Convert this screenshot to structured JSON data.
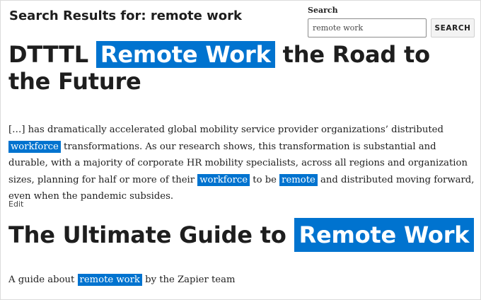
{
  "header": {
    "results_heading": "Search Results for: remote work"
  },
  "search": {
    "label": "Search",
    "value": "remote work",
    "button_label": "SEARCH"
  },
  "posts": [
    {
      "title_before": "DTTTL",
      "title_highlight": "Remote Work",
      "title_after": "the Road to the Future",
      "excerpt": {
        "p1": "[…] has dramatically accelerated global mobility service provider organizations’ distributed",
        "hl1": "workforce",
        "p2": "transformations. As our research shows, this transformation is substantial and durable, with a majority of corporate HR mobility specialists, across all regions and organization sizes, planning for half or more of their",
        "hl2": "workforce",
        "p3": "to be",
        "hl3": "remote",
        "p4": "and distributed moving forward, even when the pandemic subsides."
      },
      "edit_label": "Edit"
    },
    {
      "title_before": "The Ultimate Guide to",
      "title_highlight": "Remote Work",
      "excerpt": {
        "p1": "A guide about",
        "hl1": "remote work",
        "p2": "by the Zapier team"
      }
    }
  ],
  "colors": {
    "highlight_bg": "#0073cf",
    "highlight_text": "#ffffff",
    "text": "#1e1e1e"
  }
}
